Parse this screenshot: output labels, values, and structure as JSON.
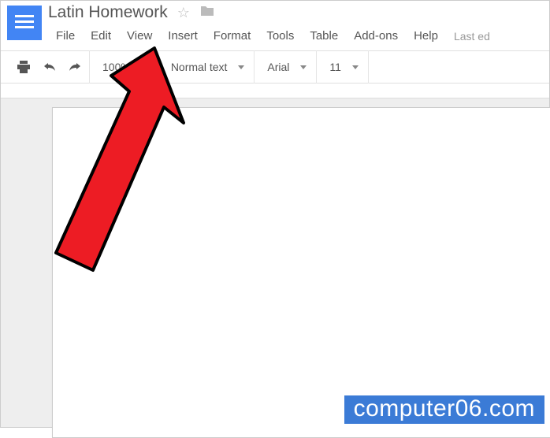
{
  "document": {
    "title": "Latin Homework"
  },
  "menus": {
    "file": "File",
    "edit": "Edit",
    "view": "View",
    "insert": "Insert",
    "format": "Format",
    "tools": "Tools",
    "table": "Table",
    "addons": "Add-ons",
    "help": "Help",
    "last_edit": "Last ed"
  },
  "toolbar": {
    "zoom": "100%",
    "paragraph_style": "Normal text",
    "font_family": "Arial",
    "font_size": "11"
  },
  "watermark": {
    "text": "computer06.com"
  }
}
